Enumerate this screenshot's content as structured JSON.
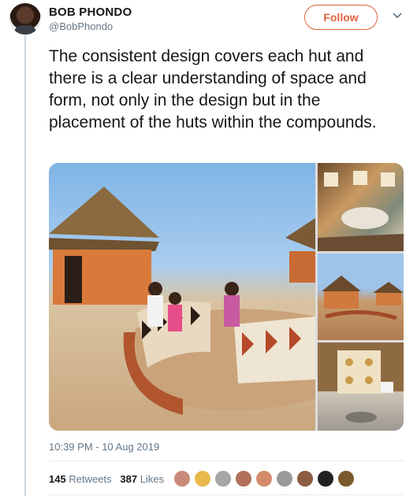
{
  "user": {
    "name": "BOB PHONDO",
    "handle": "@BobPhondo"
  },
  "follow_label": "Follow",
  "tweet_text": "The consistent design covers each hut and there is a clear understanding of space and form, not only in the design but in the placement of the huts within the compounds.",
  "timestamp": "10:39 PM - 10 Aug 2019",
  "stats": {
    "retweets_count": "145",
    "retweets_label": "Retweets",
    "likes_count": "387",
    "likes_label": "Likes"
  },
  "colors": {
    "accent": "#e0613f",
    "secondary_text": "#657786"
  },
  "icons": {
    "more": "chevron-down-icon"
  }
}
